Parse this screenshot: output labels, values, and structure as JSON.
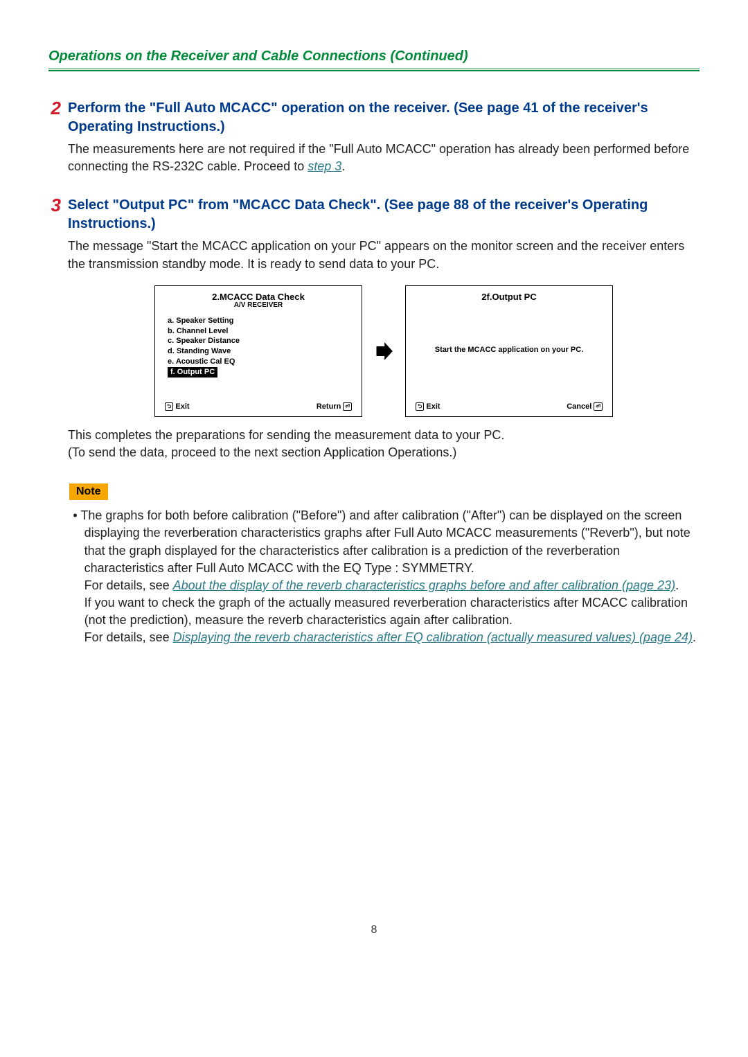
{
  "header": {
    "title": "Operations on the Receiver and Cable Connections (Continued)"
  },
  "step2": {
    "num": "2",
    "heading": "Perform the \"Full Auto MCACC\" operation on the receiver. (See page 41 of the receiver's Operating Instructions.)",
    "text_pre": "The measurements here are not required if the \"Full Auto MCACC\" operation has already been performed before connecting the RS-232C cable. Proceed to ",
    "link": "step 3",
    "text_post": "."
  },
  "step3": {
    "num": "3",
    "heading": "Select \"Output PC\" from \"MCACC Data Check\". (See page 88 of the receiver's Operating Instructions.)",
    "text": "The message \"Start the MCACC application on your PC\" appears on the monitor screen and the receiver enters the transmission standby mode. It is ready to send data to your PC.",
    "after1": "This completes the preparations for sending the measurement data to your PC.",
    "after2": "(To send the data, proceed to the next section Application Operations.)"
  },
  "menu_left": {
    "title": "2.MCACC Data Check",
    "subtitle": "A/V RECEIVER",
    "items": {
      "a": "a. Speaker Setting",
      "b": "b. Channel Level",
      "c": "c. Speaker Distance",
      "d": "d. Standing Wave",
      "e": "e. Acoustic Cal EQ",
      "f": " f.  Output PC "
    },
    "exit_label": "Exit",
    "return_label": "Return"
  },
  "menu_right": {
    "title": "2f.Output PC",
    "message": "Start the MCACC application on your PC.",
    "exit_label": "Exit",
    "cancel_label": "Cancel"
  },
  "note": {
    "label": "Note",
    "bullet_text1": "The graphs for both before calibration (\"Before\") and after calibration (\"After\") can be displayed on the screen displaying the reverberation characteristics graphs after Full Auto MCACC measurements (\"Reverb\"), but note that the graph displayed for the characteristics after calibration is a prediction of the reverberation characteristics after Full Auto MCACC with the EQ Type : SYMMETRY.",
    "details_prefix": "For details, see ",
    "link1": "About the display of the reverb characteristics graphs before and after calibration (page 23)",
    "text2": "If you want to check the graph of the actually measured reverberation characteristics after MCACC calibration (not the prediction), measure the reverb characteristics again after calibration.",
    "link2": "Displaying the reverb characteristics after EQ calibration (actually measured values) (page 24)",
    "period": "."
  },
  "page_number": "8"
}
